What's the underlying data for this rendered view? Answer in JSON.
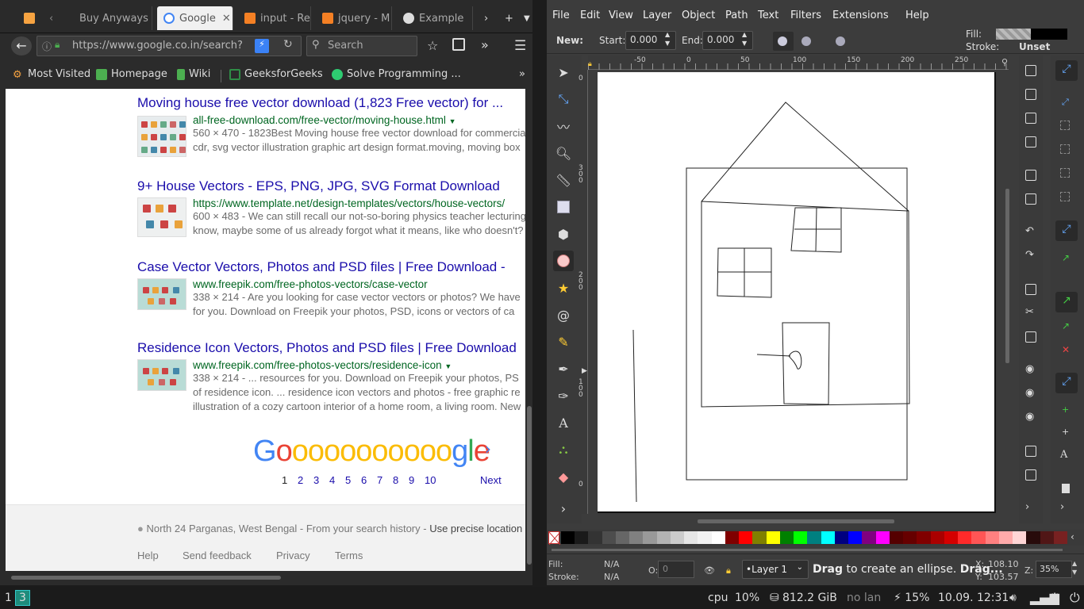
{
  "firefox": {
    "tabs": [
      {
        "label": "",
        "color": "#f6a341"
      },
      {
        "label": "Buy Anyways",
        "color": "#444"
      },
      {
        "label": "Google",
        "color": "#4285f4"
      },
      {
        "label": "input - Re",
        "color": "#f48024"
      },
      {
        "label": "jquery - M",
        "color": "#f48024"
      },
      {
        "label": "Example",
        "color": "#ffffff"
      }
    ],
    "url": "https://www.google.co.in/search?",
    "search_placeholder": "Search",
    "bookmarks": [
      {
        "label": "Most Visited",
        "icon": "gear-icon"
      },
      {
        "label": "Homepage",
        "icon": "bookmark-icon"
      },
      {
        "label": "Wiki",
        "icon": "bookmark-icon"
      },
      {
        "label": "GeeksforGeeks",
        "icon": "gfg-icon"
      },
      {
        "label": "Solve Programming ...",
        "icon": "hackerearth-icon"
      }
    ],
    "results": [
      {
        "title": "Moving house free vector download (1,823 Free vector) for ...",
        "url": "all-free-download.com/free-vector/moving-house.html",
        "size": "560 × 470",
        "desc1": "1823Best Moving house free vector download for commercial",
        "desc2": "cdr, svg vector illustration graphic art design format.moving, moving box"
      },
      {
        "title": "9+ House Vectors - EPS, PNG, JPG, SVG Format Download",
        "url": "https://www.template.net/design-templates/vectors/house-vectors/",
        "size": "600 × 483",
        "desc1": "We can still recall our not-so-boring physics teacher lecturing",
        "desc2": "know, maybe some of us already forgot what it means, like who doesn't?"
      },
      {
        "title": "Case Vector Vectors, Photos and PSD files | Free Download - ",
        "url": "www.freepik.com/free-photos-vectors/case-vector",
        "size": "338 × 214",
        "desc1": "Are you looking for case vector vectors or photos? We have",
        "desc2": "for you. Download on Freepik your photos, PSD, icons or vectors of ca"
      },
      {
        "title": "Residence Icon Vectors, Photos and PSD files | Free Download",
        "url": "www.freepik.com/free-photos-vectors/residence-icon",
        "size": "338 × 214",
        "desc1": "... resources for you. Download on Freepik your photos, PS",
        "desc2": "of residence icon. ... residence icon vectors and photos - free graphic re",
        "desc3": "illustration of a cozy cartoon interior of a home room, a living room. New"
      }
    ],
    "pager": {
      "logo": "Gooooooooooogle",
      "pages": [
        "1",
        "2",
        "3",
        "4",
        "5",
        "6",
        "7",
        "8",
        "9",
        "10"
      ],
      "next": "Next"
    },
    "footer": {
      "location": "North 24 Parganas, West Bengal",
      "location_note": " - From your search history - ",
      "precise": "Use precise location",
      "links": [
        "Help",
        "Send feedback",
        "Privacy",
        "Terms"
      ]
    }
  },
  "inkscape": {
    "menu": [
      "File",
      "Edit",
      "View",
      "Layer",
      "Object",
      "Path",
      "Text",
      "Filters",
      "Extensions",
      "Help"
    ],
    "ctrl": {
      "mode": "New:",
      "start_label": "Start:",
      "start_value": "0.000",
      "end_label": "End:",
      "end_value": "0.000",
      "fill_label": "Fill:",
      "stroke_label": "Stroke:",
      "stroke_value": "Unset"
    },
    "ruler_h": [
      "-50",
      "0",
      "50",
      "100",
      "150",
      "200",
      "250"
    ],
    "ruler_v": [
      "300",
      "200",
      "100",
      "0"
    ],
    "ruler_v_top": "0",
    "palette": [
      "#000000",
      "#1a1a1a",
      "#333333",
      "#4d4d4d",
      "#666666",
      "#808080",
      "#999999",
      "#b3b3b3",
      "#cccccc",
      "#e6e6e6",
      "#f2f2f2",
      "#ffffff",
      "#800000",
      "#ff0000",
      "#808000",
      "#ffff00",
      "#008000",
      "#00ff00",
      "#008080",
      "#00ffff",
      "#000080",
      "#0000ff",
      "#800080",
      "#ff00ff",
      "#550000",
      "#660000",
      "#800000",
      "#aa0000",
      "#d40000",
      "#ff2a2a",
      "#ff5555",
      "#ff8080",
      "#ffaaaa",
      "#ffd5d5",
      "#280b0b",
      "#501616",
      "#782121"
    ],
    "status": {
      "fill_label": "Fill:",
      "fill_value": "N/A",
      "stroke_label": "Stroke:",
      "stroke_value": "N/A",
      "opacity_label": "O:",
      "opacity_value": "0",
      "layer": "•Layer 1",
      "hint_bold": "Drag",
      "hint_rest": " to create an ellipse. ",
      "hint_bold2": "Drag...",
      "x_label": "X:",
      "x_value": "108.10",
      "y_label": "Y:",
      "y_value": "103.57",
      "z_label": "Z:",
      "zoom": "35%"
    }
  },
  "taskbar": {
    "workspaces": [
      "1",
      "3"
    ],
    "cpu_label": "cpu",
    "cpu_value": "10%",
    "disk": "812.2 GiB",
    "net": "no lan",
    "battery": "⚡ 15%",
    "datetime": "10.09. 12:31"
  }
}
